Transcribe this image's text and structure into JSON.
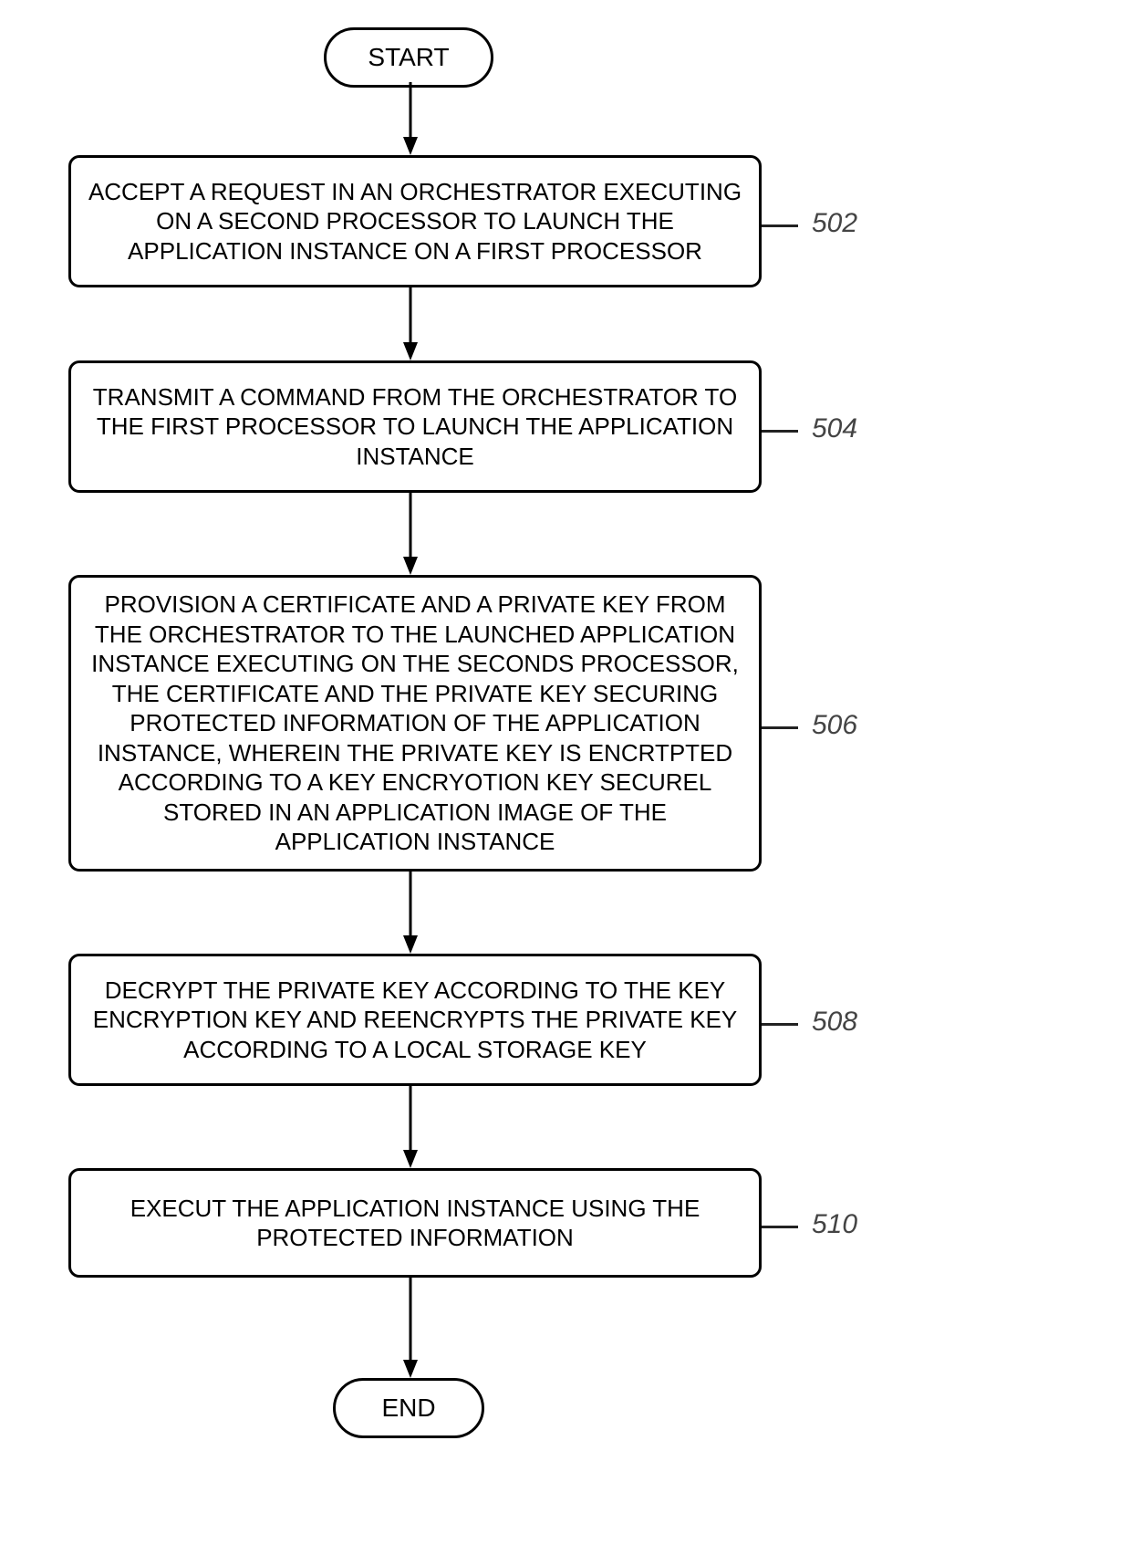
{
  "flow": {
    "start": "START",
    "end": "END",
    "steps": {
      "s1": {
        "text": "ACCEPT A REQUEST IN AN ORCHESTRATOR EXECUTING ON A SECOND PROCESSOR TO LAUNCH THE APPLICATION INSTANCE ON A FIRST PROCESSOR",
        "ref": "502"
      },
      "s2": {
        "text": "TRANSMIT A COMMAND FROM THE ORCHESTRATOR TO THE FIRST PROCESSOR TO LAUNCH THE APPLICATION INSTANCE",
        "ref": "504"
      },
      "s3": {
        "text": "PROVISION A CERTIFICATE AND A PRIVATE KEY FROM THE ORCHESTRATOR TO THE LAUNCHED APPLICATION INSTANCE EXECUTING ON THE SECONDS PROCESSOR, THE CERTIFICATE AND THE PRIVATE KEY SECURING PROTECTED INFORMATION OF THE APPLICATION INSTANCE, WHEREIN THE PRIVATE KEY IS ENCRTPTED ACCORDING TO A KEY ENCRYOTION KEY SECUREL STORED IN AN APPLICATION IMAGE OF THE APPLICATION INSTANCE",
        "ref": "506"
      },
      "s4": {
        "text": "DECRYPT THE PRIVATE KEY ACCORDING TO THE  KEY ENCRYPTION KEY AND REENCRYPTS THE PRIVATE KEY ACCORDING TO A LOCAL STORAGE KEY",
        "ref": "508"
      },
      "s5": {
        "text": "EXECUT THE APPLICATION INSTANCE USING THE PROTECTED INFORMATION",
        "ref": "510"
      }
    }
  }
}
